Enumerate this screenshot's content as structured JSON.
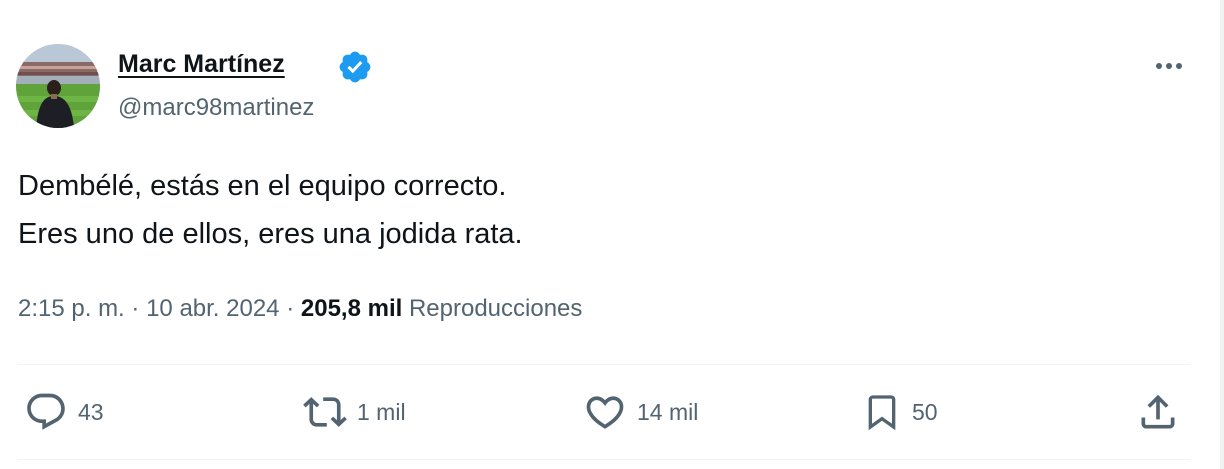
{
  "author": {
    "name": "Marc Martínez",
    "handle": "@marc98martinez",
    "verified": true
  },
  "tweet": {
    "lines": [
      "Dembélé, estás en el equipo correcto.",
      "Eres uno de ellos, eres una jodida rata."
    ]
  },
  "meta": {
    "time": "2:15 p. m.",
    "separator": "·",
    "date": "10 abr. 2024",
    "views_count": "205,8 mil",
    "views_label": "Reproducciones"
  },
  "actions": {
    "reply": {
      "count": "43",
      "icon": "reply-icon"
    },
    "retweet": {
      "count": "1 mil",
      "icon": "retweet-icon"
    },
    "like": {
      "count": "14 mil",
      "icon": "heart-icon"
    },
    "bookmark": {
      "count": "50",
      "icon": "bookmark-icon"
    },
    "share": {
      "icon": "share-icon"
    }
  },
  "colors": {
    "text_primary": "#0f1419",
    "text_secondary": "#536471",
    "verified_blue": "#1d9bf0",
    "divider": "#eff3f4"
  }
}
